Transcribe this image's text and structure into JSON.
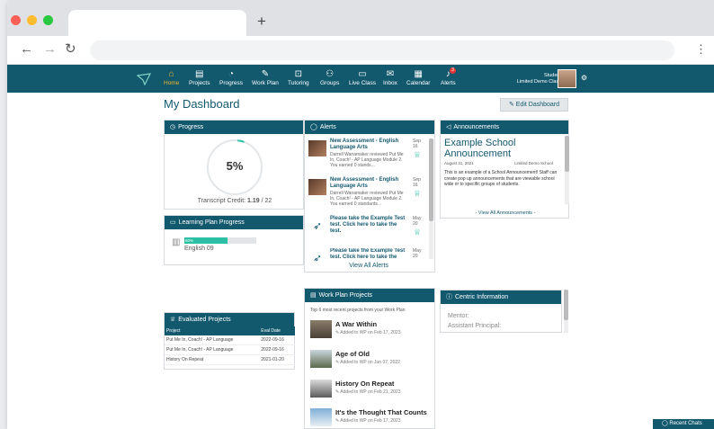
{
  "browser": {
    "new_tab": "+"
  },
  "nav": {
    "items": [
      {
        "label": "Home",
        "icon": "⌂"
      },
      {
        "label": "Projects",
        "icon": "▤"
      },
      {
        "label": "Progress",
        "icon": "◔"
      },
      {
        "label": "Work Plan",
        "icon": "✎"
      },
      {
        "label": "Tutoring",
        "icon": "⊡"
      },
      {
        "label": "Groups",
        "icon": "⚇"
      },
      {
        "label": "Live Class",
        "icon": "▭"
      },
      {
        "label": "Inbox",
        "icon": "✉"
      },
      {
        "label": "Calendar",
        "icon": "▦"
      },
      {
        "label": "Alerts",
        "icon": "♪"
      }
    ],
    "alerts_badge": "3",
    "user_name": "Student",
    "user_class": "Limited Demo Class"
  },
  "dashboard": {
    "title": "My Dashboard",
    "edit_label": "Edit Dashboard"
  },
  "progress": {
    "header": "Progress",
    "percent": "5%",
    "percent_value": 0.05,
    "credit_label": "Transcript Credit:",
    "credit_value": "1.19",
    "credit_total": "/ 22"
  },
  "learning_plan": {
    "header": "Learning Plan Progress",
    "bar_label": "60%",
    "bar_value": 0.6,
    "course": "English 09"
  },
  "alerts": {
    "header": "Alerts",
    "items": [
      {
        "title": "New Assessment - English Language Arts",
        "sub": "Darrell Wanamaker reviewed Put Me In, Coach! - AP Language Module 2. You earned 0 stands...",
        "date": "Sep 16"
      },
      {
        "title": "New Assessment - English Language Arts",
        "sub": "Darrell Wanamaker reviewed Put Me In, Coach! - AP Language Module 2. You earned 0 standards...",
        "date": "Sep 16"
      },
      {
        "title": "Please take the Example Test test. Click here to take the test.",
        "sub": "",
        "date": "May 20"
      },
      {
        "title": "Please take the Example Test test. Click here to take the test.",
        "sub": "",
        "date": "May 20"
      }
    ],
    "view_all": "View All Alerts"
  },
  "announcements": {
    "header": "Announcements",
    "title": "Example School Announcement",
    "date": "August 31, 2021",
    "class": "Limited Demo School",
    "body": "This is an example of a School Announcement! Staff can create pop up announcements that are viewable school wide or to specific groups of students.",
    "view_all": "- View All Announcements -"
  },
  "work_plan": {
    "header": "Work Plan Projects",
    "subtitle": "Top 6 most recent projects from your Work Plan",
    "items": [
      {
        "name": "A War Within",
        "meta": "✎ Added to WP on Feb 17, 2023"
      },
      {
        "name": "Age of Old",
        "meta": "✎ Added to WP on Jun 07, 2022"
      },
      {
        "name": "History On Repeat",
        "meta": "✎ Added to WP on Feb 21, 2023"
      },
      {
        "name": "It's the Thought That Counts",
        "meta": "✎ Added to WP on Feb 17, 2023"
      }
    ]
  },
  "evaluated": {
    "header": "Evaluated Projects",
    "columns": [
      "Project",
      "Eval Date"
    ],
    "rows": [
      [
        "Put Me In, Coach! - AP Language",
        "2022-09-16"
      ],
      [
        "Put Me In, Coach! - AP Language",
        "2022-09-16"
      ],
      [
        "History On Repeat",
        "2021-01-20"
      ]
    ]
  },
  "centric": {
    "header": "Centric Information",
    "mentor": "Mentor:",
    "principal": "Assistant Principal:"
  },
  "chats": {
    "label": "Recent Chats"
  },
  "colors": {
    "brand": "#13596e",
    "accent": "#2bbfa3",
    "active": "#f0b429"
  }
}
